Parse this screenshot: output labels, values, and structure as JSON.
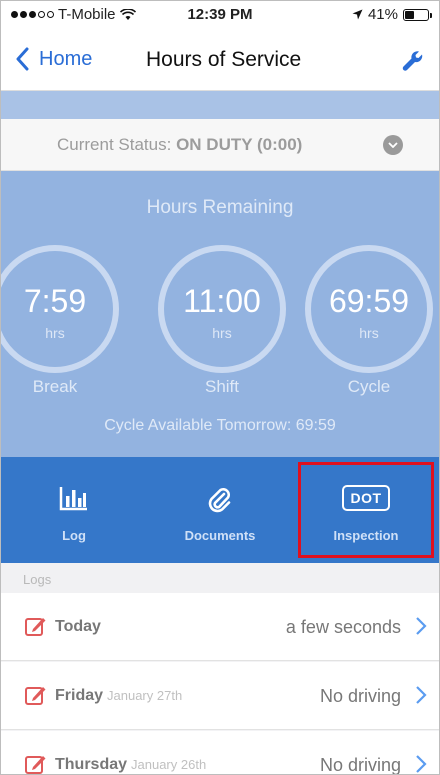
{
  "status_bar": {
    "carrier": "T-Mobile",
    "time": "12:39 PM",
    "battery": "41%",
    "battery_level": 0.41
  },
  "nav": {
    "back_label": "Home",
    "title": "Hours of Service"
  },
  "current_status": {
    "label": "Current Status:",
    "value": "ON DUTY (0:00)"
  },
  "hours": {
    "title": "Hours Remaining",
    "circles": [
      {
        "value": "7:59",
        "unit": "hrs",
        "label": "Break"
      },
      {
        "value": "11:00",
        "unit": "hrs",
        "label": "Shift"
      },
      {
        "value": "69:59",
        "unit": "hrs",
        "label": "Cycle"
      }
    ],
    "cycle_note": "Cycle Available Tomorrow: 69:59"
  },
  "tabs": [
    {
      "label": "Log",
      "icon": "bar-chart-icon"
    },
    {
      "label": "Documents",
      "icon": "paperclip-icon"
    },
    {
      "label": "Inspection",
      "icon": "dot-badge-icon",
      "badge": "DOT"
    }
  ],
  "logs": {
    "header": "Logs",
    "rows": [
      {
        "day": "Today",
        "date": "",
        "status": "a few seconds"
      },
      {
        "day": "Friday",
        "date": "January 27th",
        "status": "No driving"
      },
      {
        "day": "Thursday",
        "date": "January 26th",
        "status": "No driving"
      }
    ]
  },
  "colors": {
    "accent": "#2a6dd6",
    "tab_bar": "#3577c9",
    "hours_bg": "#93b3e0",
    "highlight": "#e0101e",
    "pencil": "#e05a5a"
  }
}
